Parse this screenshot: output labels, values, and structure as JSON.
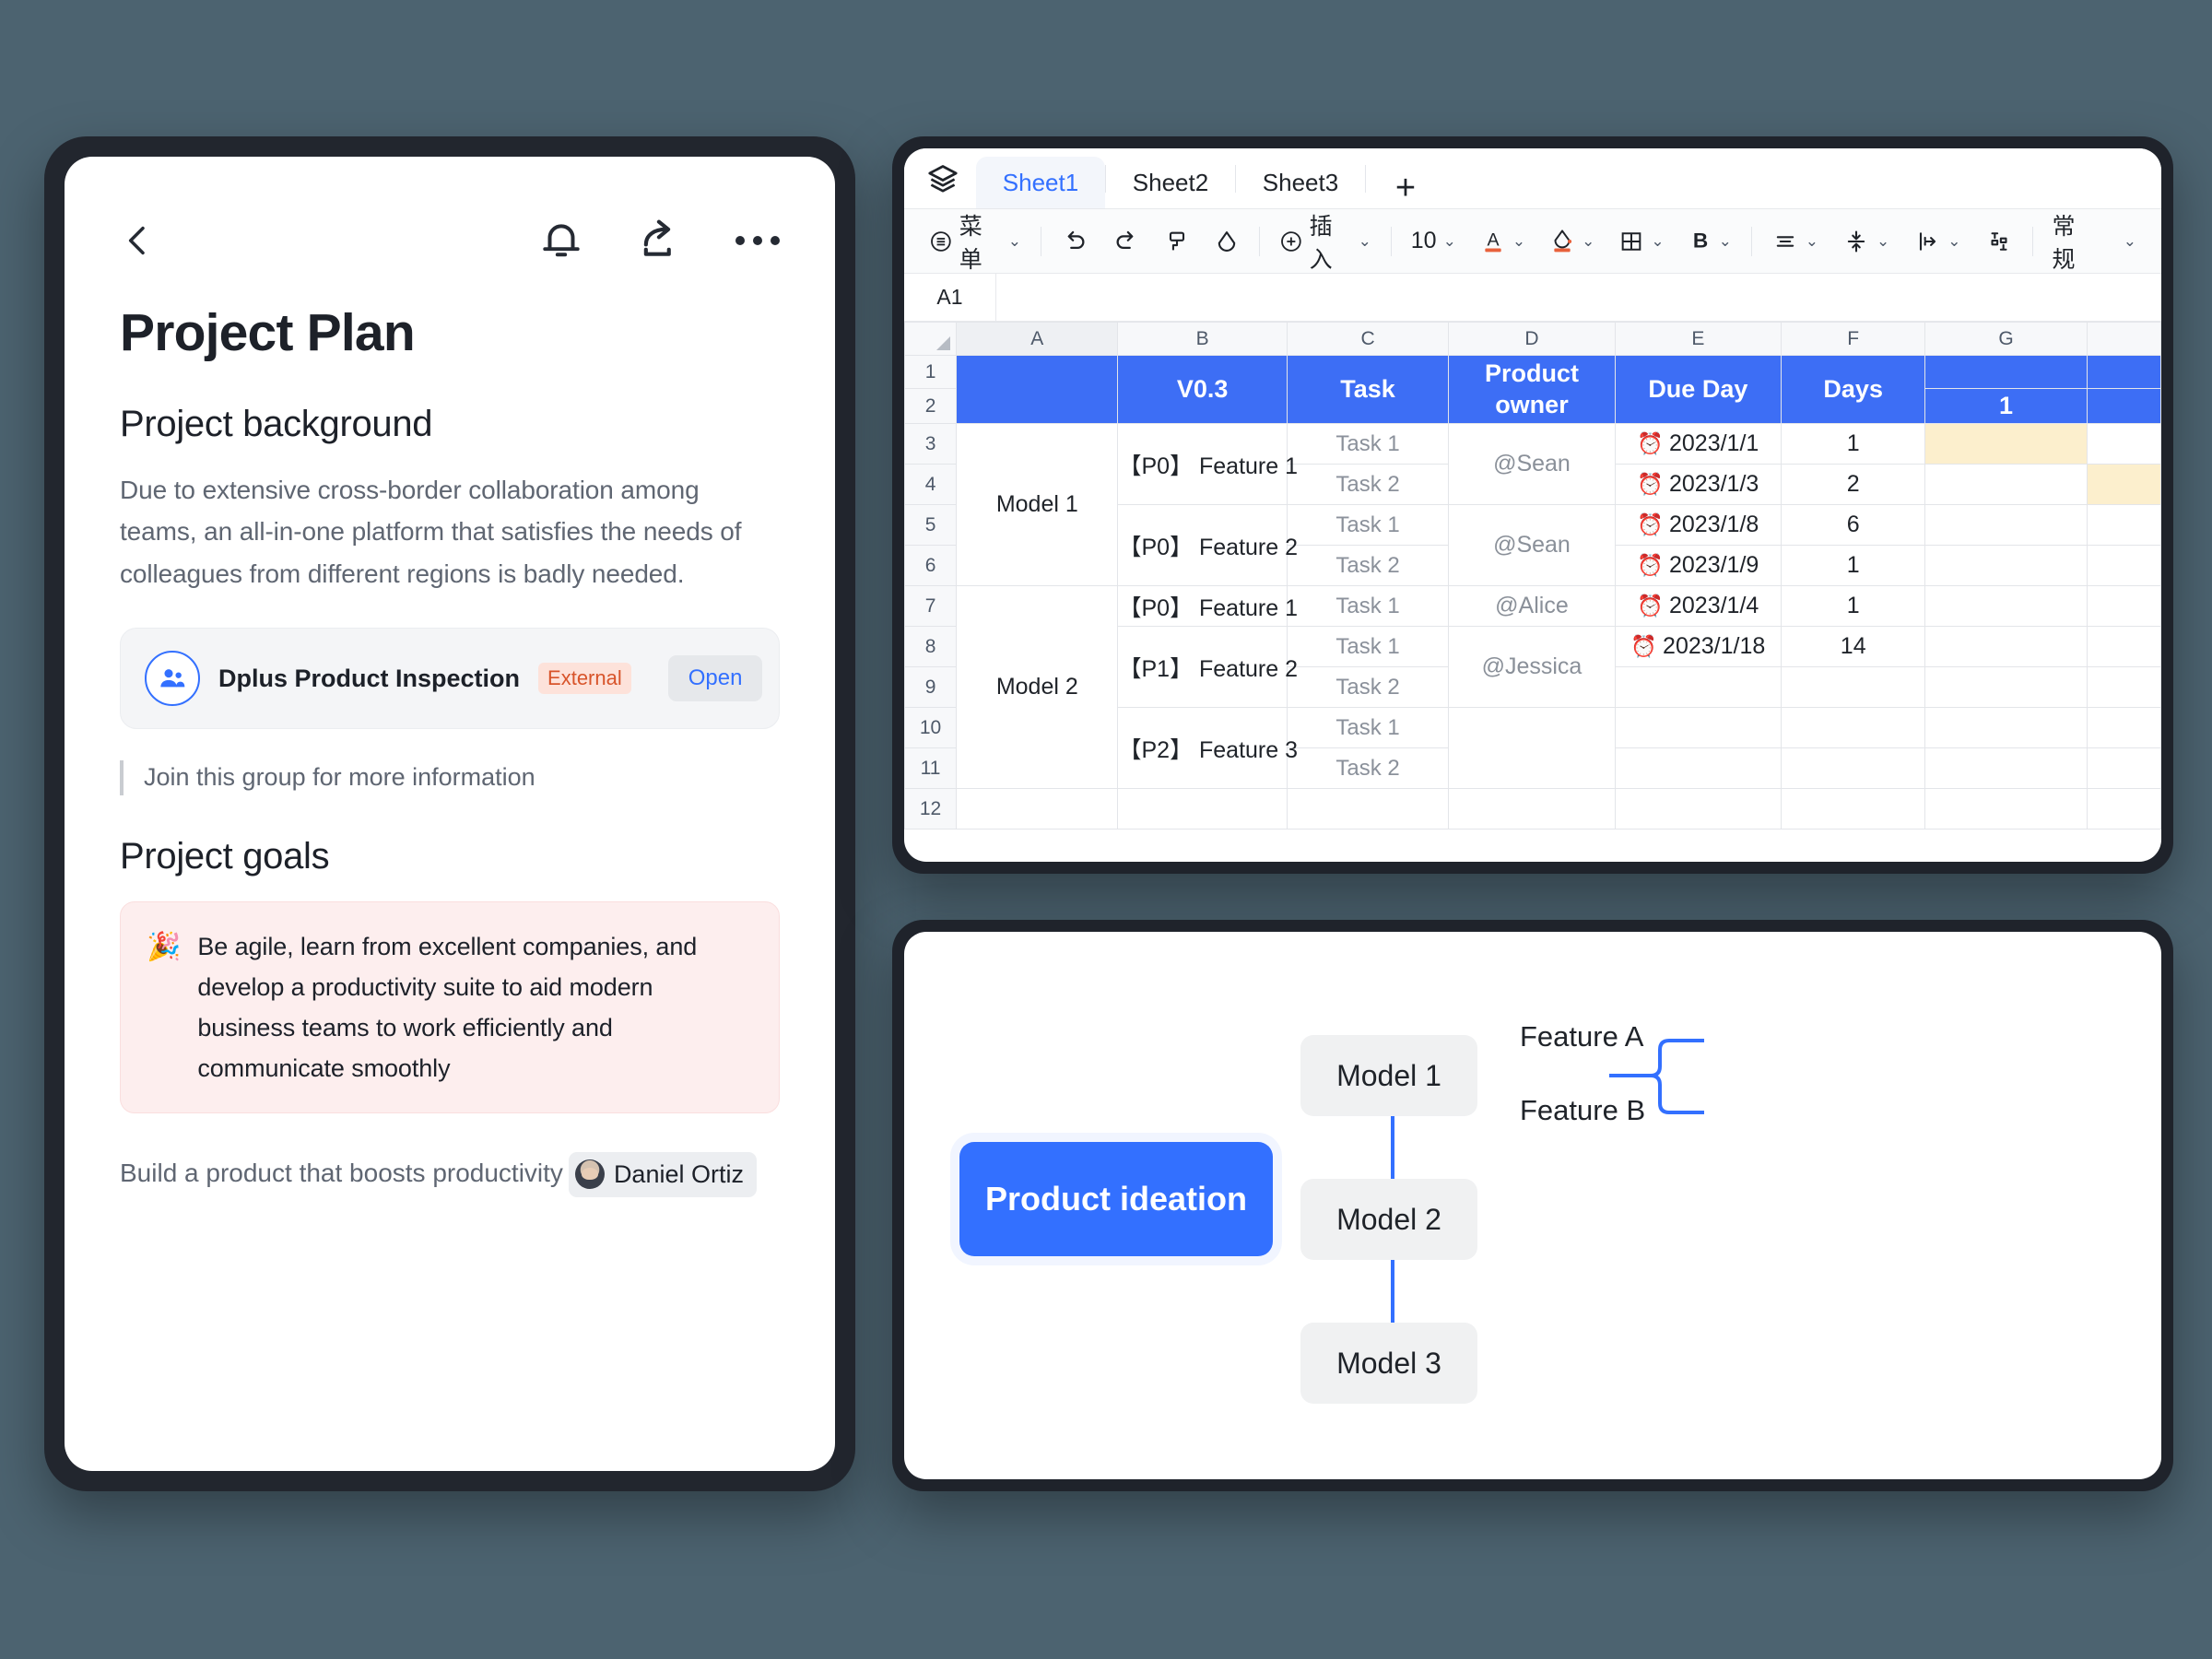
{
  "theme": {
    "background": "#4c6370",
    "accent_blue": "#3370ff",
    "header_blue": "#3d6ef5",
    "highlight_yellow": "#fcefcd",
    "tag_orange": "#d8542a"
  },
  "document_panel": {
    "toolbar": {
      "back_icon": "chevron-left-icon",
      "bell_icon": "bell-icon",
      "share_icon": "share-icon",
      "more_icon": "more-dots-icon"
    },
    "title": "Project Plan",
    "sections": [
      {
        "heading": "Project background",
        "body": "Due to extensive cross-border collaboration among teams, an all-in-one platform that satisfies the needs of colleagues from different regions is badly needed."
      }
    ],
    "group_card": {
      "avatar_icon": "group-people-icon",
      "name": "Dplus Product Inspection",
      "tag": "External",
      "action": "Open"
    },
    "quote": "Join this group for more information",
    "goals_heading": "Project goals",
    "goals_callout": {
      "emoji": "🎉",
      "text": "Be agile, learn from excellent companies, and develop a productivity suite to aid modern business teams to work efficiently and communicate smoothly"
    },
    "build_line": {
      "text": "Build a product that boosts productivity",
      "mention": "Daniel Ortiz"
    }
  },
  "spreadsheet_panel": {
    "layers_icon": "layers-icon",
    "tabs": [
      {
        "label": "Sheet1",
        "active": true
      },
      {
        "label": "Sheet2",
        "active": false
      },
      {
        "label": "Sheet3",
        "active": false
      }
    ],
    "add_tab_icon": "plus-icon",
    "toolbar": {
      "menu_icon": "menu-list-icon",
      "menu_label": "菜单",
      "undo_icon": "undo-icon",
      "redo_icon": "redo-icon",
      "format_painter_icon": "format-painter-icon",
      "clear_format_icon": "eraser-icon",
      "insert_icon": "plus-circle-icon",
      "insert_label": "插入",
      "font_size": "10",
      "text_color_icon": "text-color-A-icon",
      "fill_color_icon": "fill-bucket-icon",
      "borders_icon": "borders-grid-icon",
      "bold_icon": "bold-B-icon",
      "align_icon": "align-icon",
      "vertical_align_icon": "vertical-align-icon",
      "wrap_icon": "text-wrap-icon",
      "merge_icon": "merge-cells-icon",
      "number_format": "常规"
    },
    "name_box": "A1",
    "column_headers": [
      "A",
      "B",
      "C",
      "D",
      "E",
      "F",
      "G"
    ],
    "row_numbers": [
      "1",
      "2",
      "3",
      "4",
      "5",
      "6",
      "7",
      "8",
      "9",
      "10",
      "11",
      "12"
    ],
    "header_row": {
      "a": "",
      "b": "V0.3",
      "c": "Task",
      "d": "Product owner",
      "e": "Due Day",
      "f": "Days",
      "g_row1": "",
      "g_row2": "1"
    },
    "rows": [
      {
        "row": "3",
        "model": "Model 1",
        "feature": "【P0】 Feature 1",
        "task": "Task 1",
        "owner": "@Sean",
        "due": "2023/1/1",
        "days": "1",
        "g_highlight": true
      },
      {
        "row": "4",
        "model": "",
        "feature": "",
        "task": "Task 2",
        "owner": "",
        "due": "2023/1/3",
        "days": "2",
        "g_highlight": false
      },
      {
        "row": "5",
        "model": "",
        "feature": "【P0】 Feature 2",
        "task": "Task 1",
        "owner": "@Sean",
        "due": "2023/1/8",
        "days": "6",
        "g_highlight": false
      },
      {
        "row": "6",
        "model": "",
        "feature": "",
        "task": "Task 2",
        "owner": "",
        "due": "2023/1/9",
        "days": "1",
        "g_highlight": false
      },
      {
        "row": "7",
        "model": "Model 2",
        "feature": "【P0】 Feature 1",
        "task": "Task 1",
        "owner": "@Alice",
        "due": "2023/1/4",
        "days": "1",
        "g_highlight": false
      },
      {
        "row": "8",
        "model": "",
        "feature": "【P1】 Feature 2",
        "task": "Task 1",
        "owner": "@Jessica",
        "due": "2023/1/18",
        "days": "14",
        "g_highlight": false
      },
      {
        "row": "9",
        "model": "",
        "feature": "",
        "task": "Task 2",
        "owner": "",
        "due": "",
        "days": "",
        "g_highlight": false
      },
      {
        "row": "10",
        "model": "",
        "feature": "【P2】 Feature 3",
        "task": "Task 1",
        "owner": "",
        "due": "",
        "days": "",
        "g_highlight": false
      },
      {
        "row": "11",
        "model": "",
        "feature": "",
        "task": "Task 2",
        "owner": "",
        "due": "",
        "days": "",
        "g_highlight": false
      },
      {
        "row": "12",
        "model": "",
        "feature": "",
        "task": "",
        "owner": "",
        "due": "",
        "days": "",
        "g_highlight": false
      }
    ],
    "alarm_icon": "alarm-clock-icon"
  },
  "mindmap_panel": {
    "root": "Product ideation",
    "branches": [
      {
        "label": "Model 1",
        "children": [
          "Feature A",
          "Feature B"
        ]
      },
      {
        "label": "Model 2",
        "children": []
      },
      {
        "label": "Model 3",
        "children": []
      }
    ]
  }
}
